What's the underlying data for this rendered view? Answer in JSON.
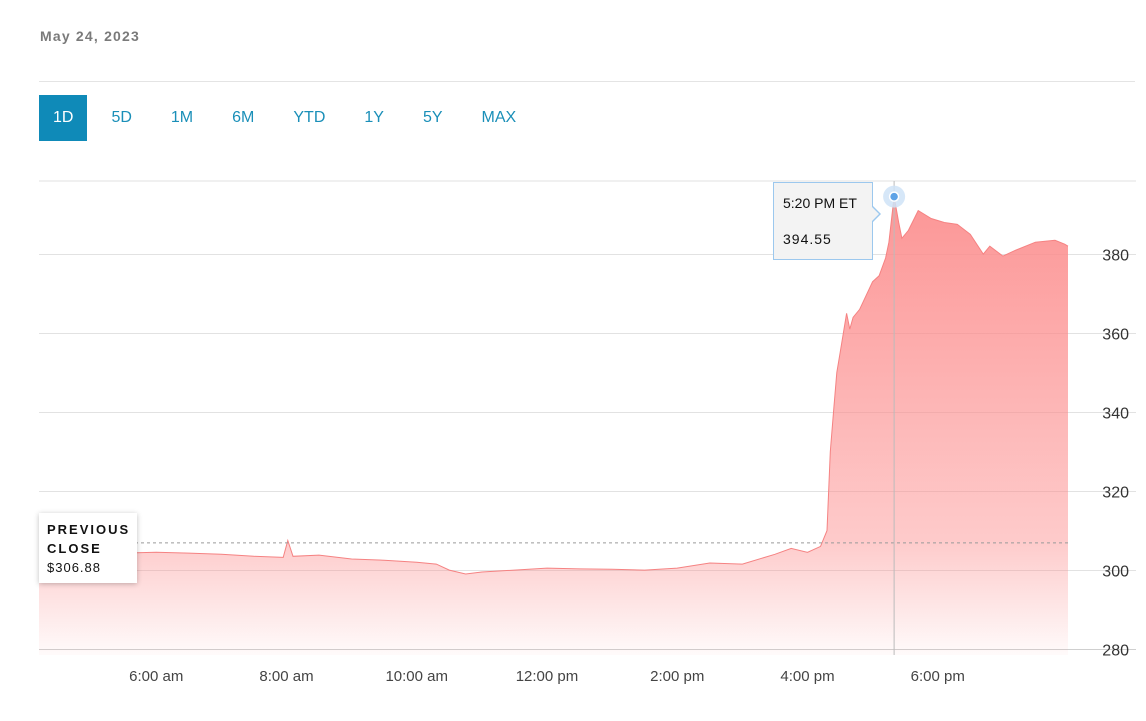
{
  "header": {
    "date": "May 24, 2023"
  },
  "range_tabs": [
    {
      "label": "1D",
      "active": true
    },
    {
      "label": "5D",
      "active": false
    },
    {
      "label": "1M",
      "active": false
    },
    {
      "label": "6M",
      "active": false
    },
    {
      "label": "YTD",
      "active": false
    },
    {
      "label": "1Y",
      "active": false
    },
    {
      "label": "5Y",
      "active": false
    },
    {
      "label": "MAX",
      "active": false
    }
  ],
  "previous_close": {
    "label_line1": "PREVIOUS",
    "label_line2": "CLOSE",
    "value": "$306.88",
    "price": 306.88
  },
  "tooltip": {
    "time": "5:20 PM ET",
    "price": "394.55"
  },
  "colors": {
    "accent": "#0f8ab8",
    "area_fill": "#fc8a8a",
    "tooltip_border": "#9cc8ee",
    "grid": "#dddddd"
  },
  "chart_data": {
    "type": "area",
    "x_unit": "hour of day (ET)",
    "x_ticks": [
      {
        "x": 6,
        "label": "6:00 am"
      },
      {
        "x": 8,
        "label": "8:00 am"
      },
      {
        "x": 10,
        "label": "10:00 am"
      },
      {
        "x": 12,
        "label": "12:00 pm"
      },
      {
        "x": 14,
        "label": "2:00 pm"
      },
      {
        "x": 16,
        "label": "4:00 pm"
      },
      {
        "x": 18,
        "label": "6:00 pm"
      }
    ],
    "y_ticks": [
      280,
      300,
      320,
      340,
      360,
      380
    ],
    "xlim": [
      4.2,
      20.0
    ],
    "ylim": [
      278.5,
      398.5
    ],
    "grid": true,
    "baseline": 306.88,
    "hover": {
      "x": 17.33,
      "y": 394.55
    },
    "series": [
      {
        "x": [
          4.2,
          5.0,
          5.5,
          6.0,
          6.5,
          7.0,
          7.5,
          7.95,
          8.02,
          8.1,
          8.5,
          9.0,
          9.5,
          10.0,
          10.3,
          10.5,
          10.75,
          11.0,
          11.5,
          12.0,
          12.5,
          13.0,
          13.5,
          14.0,
          14.5,
          15.0,
          15.5,
          15.75,
          16.0,
          16.2,
          16.3,
          16.35,
          16.4,
          16.45,
          16.5,
          16.6,
          16.65,
          16.7,
          16.8,
          17.0,
          17.1,
          17.2,
          17.25,
          17.33,
          17.4,
          17.45,
          17.55,
          17.7,
          17.9,
          18.1,
          18.3,
          18.5,
          18.7,
          18.8,
          19.0,
          19.2,
          19.5,
          19.8,
          19.95,
          20.0
        ],
        "y": [
          304.5,
          304.8,
          304.3,
          304.5,
          304.3,
          304.0,
          303.5,
          303.2,
          307.5,
          303.5,
          303.8,
          302.8,
          302.5,
          302.0,
          301.5,
          300.0,
          299.0,
          299.5,
          300.0,
          300.5,
          300.3,
          300.2,
          300.0,
          300.5,
          301.8,
          301.5,
          304.0,
          305.5,
          304.5,
          306.0,
          310.0,
          330.0,
          340.0,
          350.0,
          355.0,
          365.0,
          361.0,
          364.0,
          366.0,
          373.0,
          374.5,
          379.0,
          383.0,
          394.55,
          388.0,
          384.0,
          386.0,
          391.0,
          389.0,
          388.0,
          387.5,
          385.0,
          380.0,
          382.0,
          379.5,
          381.0,
          383.0,
          383.5,
          382.5,
          382.0
        ]
      }
    ]
  }
}
